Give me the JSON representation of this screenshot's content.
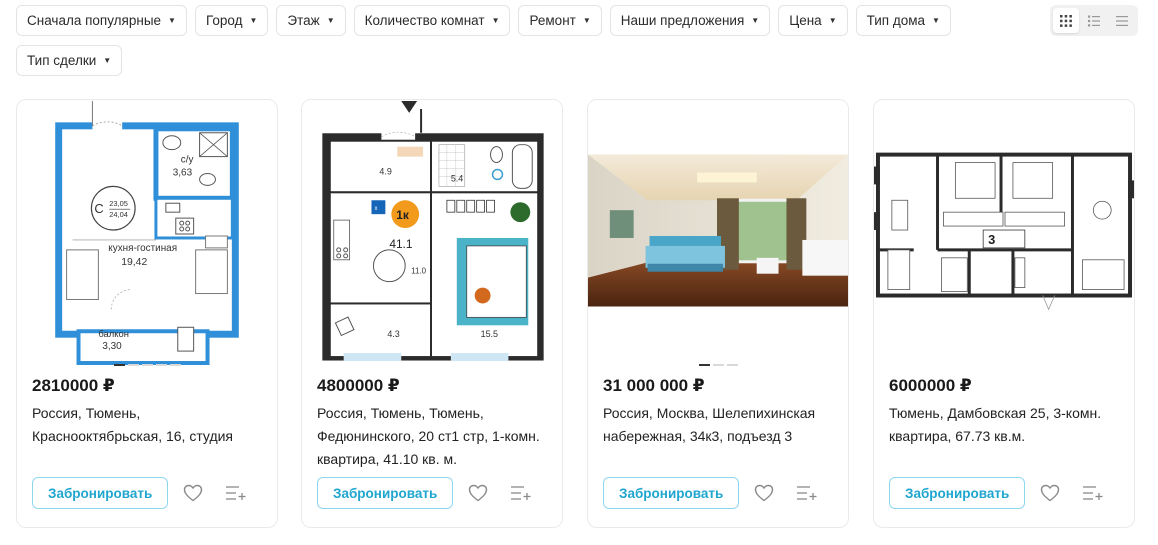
{
  "filters": [
    {
      "label": "Сначала популярные"
    },
    {
      "label": "Город"
    },
    {
      "label": "Этаж"
    },
    {
      "label": "Количество комнат"
    },
    {
      "label": "Ремонт"
    },
    {
      "label": "Наши предложения"
    },
    {
      "label": "Цена"
    },
    {
      "label": "Тип дома"
    },
    {
      "label": "Тип сделки"
    }
  ],
  "view_modes": [
    "grid-view-icon",
    "list-view-icon",
    "compact-list-view-icon"
  ],
  "plan1": {
    "su_label": "с/у",
    "su_area": "3,63",
    "class_letter": "C",
    "class_top": "23,05",
    "class_bottom": "24,04",
    "kitchen_label": "кухня-гостиная",
    "kitchen_area": "19,42",
    "balcony_label": "балкон",
    "balcony_area": "3,30"
  },
  "plan2": {
    "badge": "1к",
    "total_area": "41.1",
    "room_a": "4.9",
    "room_b": "5.4",
    "room_c": "11.0",
    "room_d": "4.3",
    "room_e": "15.5"
  },
  "plan4": {
    "badge": "3"
  },
  "listings": [
    {
      "price": "2810000 ₽",
      "address": "Россия, Тюмень, Краснооктябрьская, 16, студия",
      "book_label": "Забронировать"
    },
    {
      "price": "4800000 ₽",
      "address": "Россия, Тюмень, Тюмень, Федюнинского, 20 ст1 стр, 1-комн. квартира, 41.10 кв. м.",
      "book_label": "Забронировать"
    },
    {
      "price": "31 000 000 ₽",
      "address": "Россия, Москва, Шелепихинская набережная, 34к3, подъезд 3",
      "book_label": "Забронировать"
    },
    {
      "price": "6000000 ₽",
      "address": "Тюмень, Дамбовская 25, 3-комн. квартира, 67.73 кв.м.",
      "book_label": "Забронировать"
    }
  ],
  "colors": {
    "accent": "#1fa6cf",
    "plan_blue": "#2f8fd8",
    "plan_dark": "#2b2b2b",
    "badge_orange": "#f29a1c"
  }
}
